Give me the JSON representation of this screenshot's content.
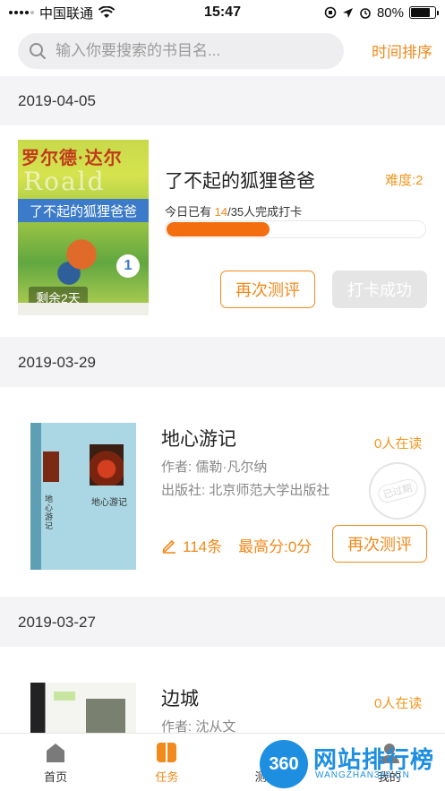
{
  "status_bar": {
    "carrier": "中国联通",
    "time": "15:47",
    "battery": "80%"
  },
  "search": {
    "placeholder": "输入你要搜索的书目名...",
    "sort_label": "时间排序"
  },
  "sections": [
    {
      "date": "2019-04-05",
      "book": {
        "title": "了不起的狐狸爸爸",
        "difficulty": "难度:2",
        "progress_prefix": "今日已有 ",
        "progress_done": "14",
        "progress_suffix": "/35人完成打卡",
        "progress_fraction": 0.4,
        "cover_author_cn": "罗尔德·达尔",
        "cover_author_en": "Roald Dahl",
        "cover_title": "了不起的狐狸爸爸",
        "cover_badge": "剩余2天",
        "retest_label": "再次测评",
        "checkin_label": "打卡成功"
      }
    },
    {
      "date": "2019-03-29",
      "book": {
        "title": "地心游记",
        "reading": "0人在读",
        "author": "作者: 儒勒·凡尔纳",
        "publisher": "出版社: 北京师范大学出版社",
        "stamp": "已过期",
        "count": "114条",
        "high_score": "最高分:0分",
        "retest_label": "再次测评",
        "cover_title": "地心游记"
      }
    },
    {
      "date": "2019-03-27",
      "book": {
        "title": "边城",
        "reading": "0人在读",
        "author": "作者: 沈从文"
      }
    }
  ],
  "tabs": [
    {
      "label": "首页",
      "icon": "home-icon"
    },
    {
      "label": "任务",
      "icon": "task-icon",
      "active": true
    },
    {
      "label": "测评报告",
      "icon": "report-icon"
    },
    {
      "label": "我的",
      "icon": "profile-icon"
    }
  ],
  "watermark": {
    "badge": "360",
    "main": "网站排行榜",
    "sub": "WANGZHAN360.CN"
  },
  "colors": {
    "accent": "#f08a1c",
    "progress_fill": "#f46d0f",
    "background": "#f4f4f6"
  }
}
